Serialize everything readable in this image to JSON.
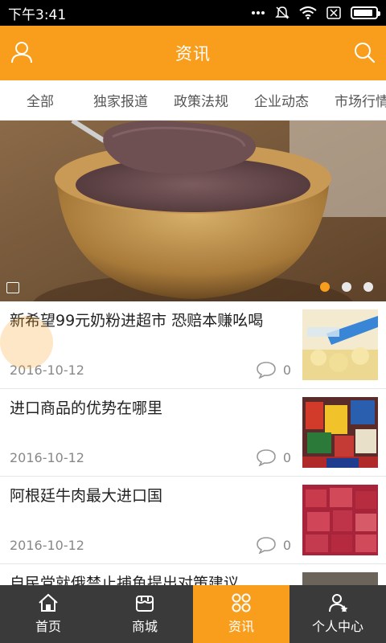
{
  "status_bar": {
    "time": "下午3:41",
    "icons": [
      "more-dots-icon",
      "mute-bell-icon",
      "wifi-icon",
      "sim-x-icon",
      "battery-icon"
    ],
    "battery_level": 0.9
  },
  "header": {
    "title": "资讯",
    "left_icon": "user-icon",
    "right_icon": "search-icon"
  },
  "tabs": [
    {
      "label": "全部"
    },
    {
      "label": "独家报道"
    },
    {
      "label": "政策法规"
    },
    {
      "label": "企业动态"
    },
    {
      "label": "市场行情"
    }
  ],
  "banner": {
    "slide_count": 3,
    "active_slide": 1
  },
  "news": [
    {
      "title": "新希望99元奶粉进超市 恐赔本赚吆喝",
      "date": "2016-10-12",
      "comments": "0"
    },
    {
      "title": "进口商品的优势在哪里",
      "date": "2016-10-12",
      "comments": "0"
    },
    {
      "title": "阿根廷牛肉最大进口国",
      "date": "2016-10-12",
      "comments": "0"
    },
    {
      "title": "自民党就俄禁止捕鱼提出对策建议",
      "date": "",
      "comments": ""
    }
  ],
  "bottom_nav": [
    {
      "label": "首页",
      "icon": "home-icon"
    },
    {
      "label": "商城",
      "icon": "shop-icon"
    },
    {
      "label": "资讯",
      "icon": "news-grid-icon",
      "active": true
    },
    {
      "label": "个人中心",
      "icon": "profile-icon"
    }
  ],
  "colors": {
    "accent": "#f99e1c",
    "nav_background": "#3a3a3a",
    "status_bar": "#000000"
  }
}
